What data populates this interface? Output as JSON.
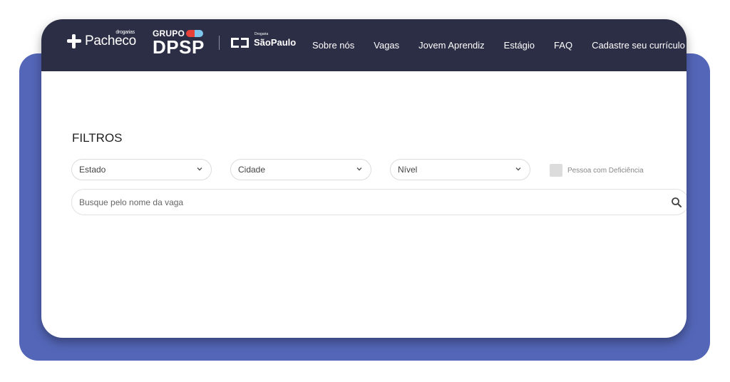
{
  "header": {
    "pacheco_logo": {
      "tag": "drogarias",
      "name": "Pacheco"
    },
    "dpsp_logo": {
      "line1": "GRUPO",
      "line2": "DPSP"
    },
    "saopaulo_logo": {
      "tag": "Drogaria",
      "name": "SãoPaulo"
    },
    "nav": [
      {
        "label": "Sobre nós"
      },
      {
        "label": "Vagas"
      },
      {
        "label": "Jovem Aprendiz"
      },
      {
        "label": "Estágio"
      },
      {
        "label": "FAQ"
      },
      {
        "label": "Cadastre seu currículo"
      }
    ]
  },
  "filters": {
    "title": "FILTROS",
    "estado": "Estado",
    "cidade": "Cidade",
    "nivel": "Nível",
    "pcd_label": "Pessoa com Deficiência",
    "search_placeholder": "Busque pelo nome da vaga"
  },
  "colors": {
    "header_bg": "#2b2e45",
    "backdrop": "#5466b8"
  }
}
